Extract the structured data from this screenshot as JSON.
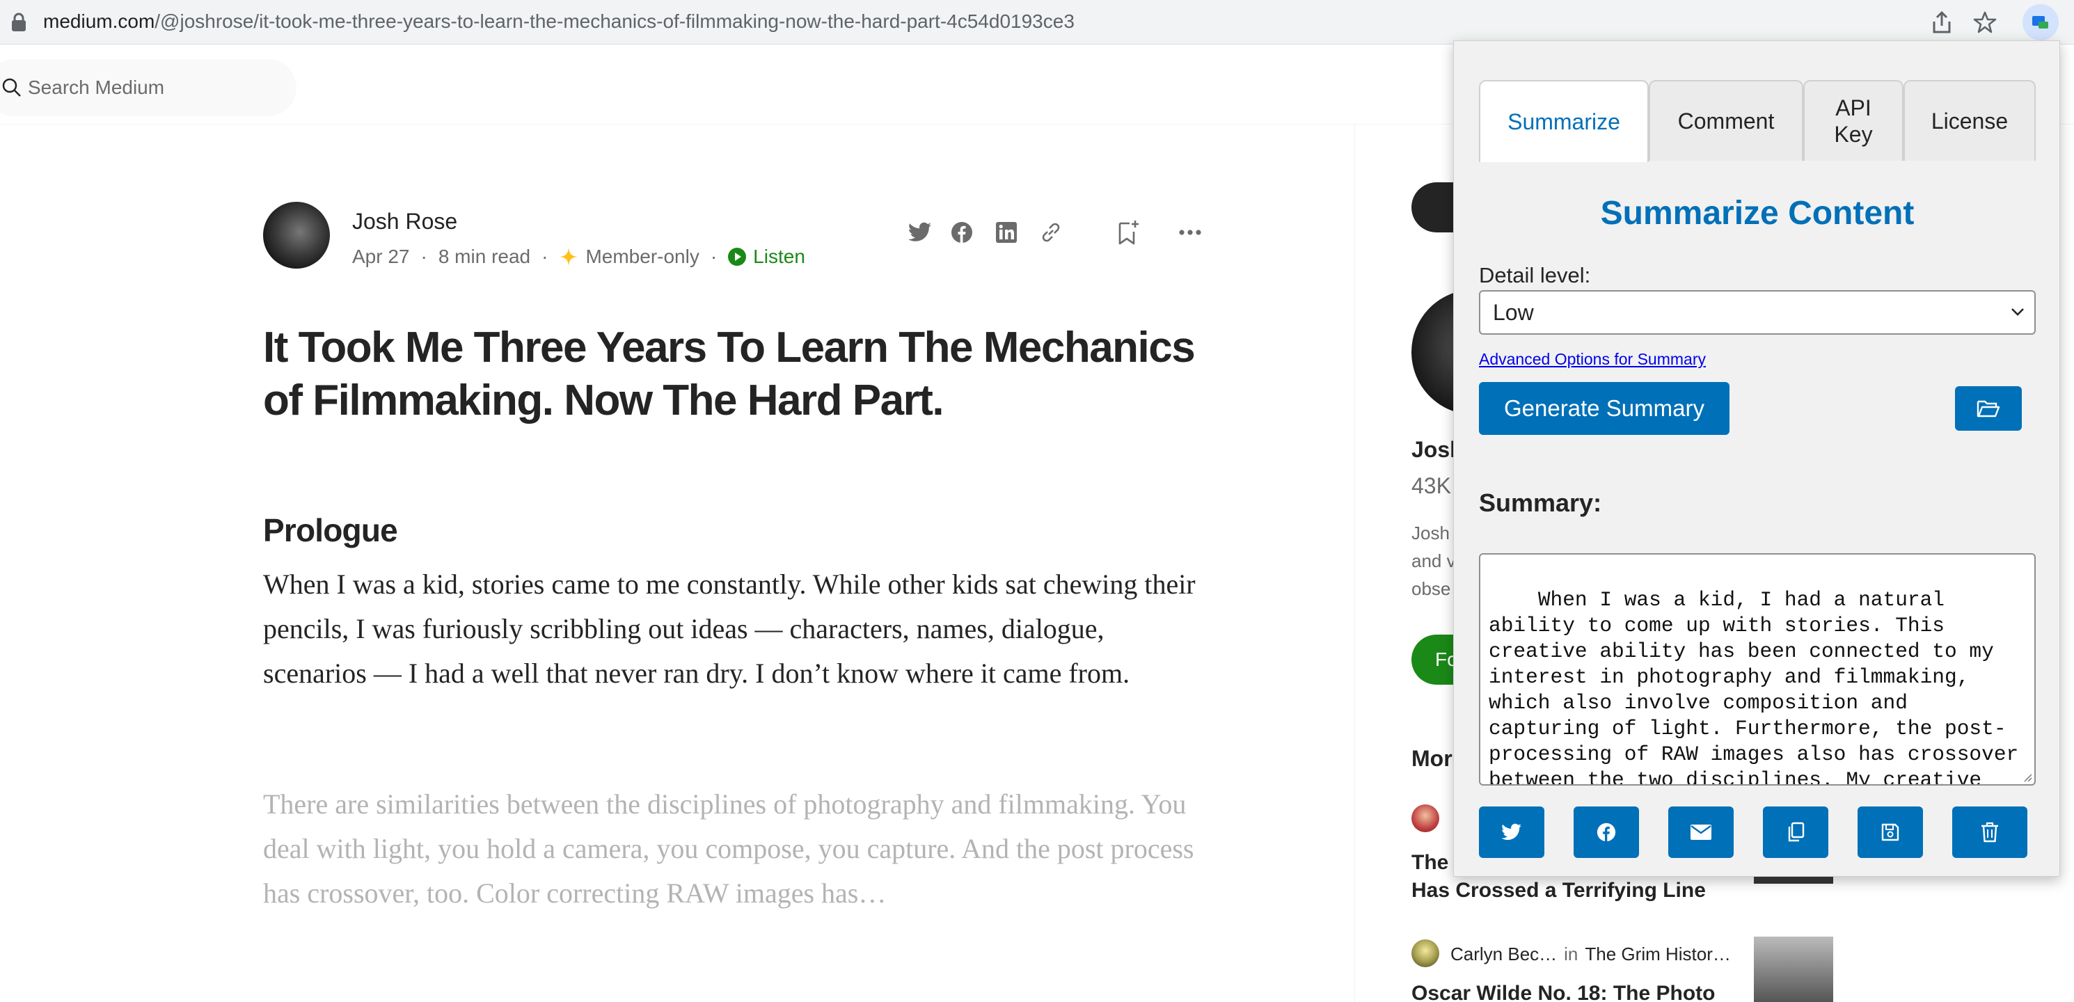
{
  "browser": {
    "url_host": "medium.com",
    "url_path": "/@joshrose/it-took-me-three-years-to-learn-the-mechanics-of-filmmaking-now-the-hard-part-4c54d0193ce3"
  },
  "header": {
    "search_placeholder": "Search Medium"
  },
  "article": {
    "author": "Josh Rose",
    "date": "Apr 27",
    "read_time": "8 min read",
    "member_label": "Member-only",
    "listen_label": "Listen",
    "title": "It Took Me Three Years To Learn The Mechanics of Filmmaking. Now The Hard Part.",
    "subheading": "Prologue",
    "paragraph_1": "When I was a kid, stories came to me constantly. While other kids sat chewing their pencils, I was furiously scribbling out ideas — characters, names, dialogue, scenarios — I had a well that never ran dry. I don’t know where it came from.",
    "paragraph_2": "There are similarities between the disciplines of photography and filmmaking. You deal with light, you hold a camera, you compose, you capture. And the post process has crossover, too. Color correcting RAW images has…"
  },
  "sidebar": {
    "author_name_partial": "Josh",
    "followers_partial": "43K",
    "bio_partial": [
      "Josh",
      "and v",
      "obse"
    ],
    "follow_partial": "Fo",
    "more_partial": "More",
    "rec_1_title": [
      "The",
      "Has Crossed a Terrifying Line"
    ],
    "rec_2_author": "Carlyn Bec…",
    "rec_2_in": "in",
    "rec_2_publication": "The Grim Histor…",
    "rec_2_title": "Oscar Wilde No. 18: The Photo"
  },
  "extension": {
    "tabs": [
      {
        "label": "Summarize",
        "active": true
      },
      {
        "label": "Comment",
        "active": false
      },
      {
        "label": "API\nKey",
        "active": false
      },
      {
        "label": "License",
        "active": false
      }
    ],
    "heading": "Summarize Content",
    "detail_label": "Detail level:",
    "detail_value": "Low",
    "advanced_link": "Advanced Options for Summary",
    "generate_button": "Generate Summary",
    "summary_label": "Summary:",
    "summary_text": "When I was a kid, I had a natural ability to come up with stories. This creative ability has been connected to my interest in photography and filmmaking, which also involve composition and capturing of light. Furthermore, the post-processing of RAW images also has crossover between the two disciplines. My creative ability as",
    "action_icons": [
      "twitter-icon",
      "facebook-icon",
      "email-icon",
      "copy-icon",
      "save-icon",
      "trash-icon"
    ],
    "accent_color": "#0070b8"
  }
}
